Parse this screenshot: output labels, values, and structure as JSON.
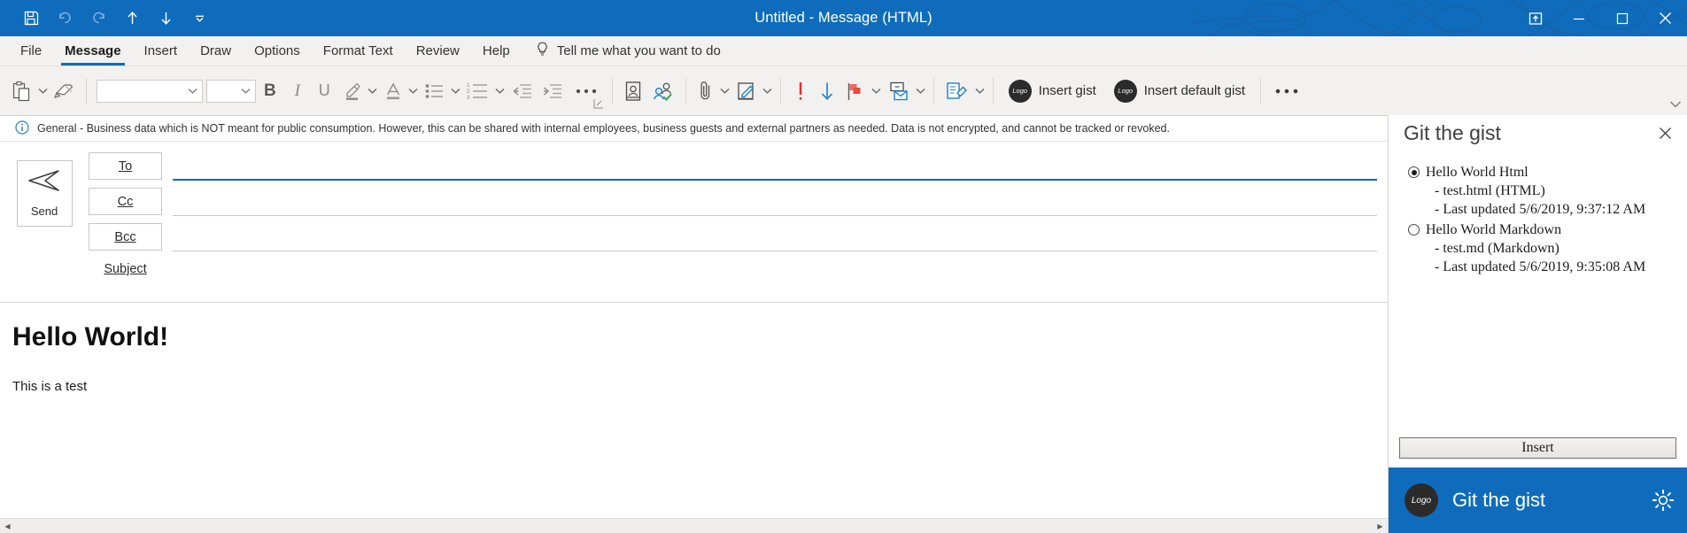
{
  "window": {
    "title": "Untitled  -  Message (HTML)",
    "quick_access": [
      {
        "name": "save-button",
        "label": "Save",
        "disabled": false
      },
      {
        "name": "undo-button",
        "label": "Undo",
        "disabled": true
      },
      {
        "name": "redo-button",
        "label": "Redo",
        "disabled": true
      },
      {
        "name": "previous-item-button",
        "label": "Previous Item",
        "disabled": false
      },
      {
        "name": "next-item-button",
        "label": "Next Item",
        "disabled": false
      },
      {
        "name": "customize-quick-access-toolbar-button",
        "label": "Customize Quick Access Toolbar",
        "disabled": false
      }
    ],
    "controls": [
      {
        "name": "ribbon-display-options-button",
        "label": "Ribbon Display Options"
      },
      {
        "name": "minimize-button",
        "label": "Minimize"
      },
      {
        "name": "maximize-button",
        "label": "Maximize"
      },
      {
        "name": "close-button",
        "label": "Close"
      }
    ],
    "accent_color": "#0f6cbd"
  },
  "ribbon": {
    "tabs": [
      {
        "label": "File",
        "active": false
      },
      {
        "label": "Message",
        "active": true
      },
      {
        "label": "Insert",
        "active": false
      },
      {
        "label": "Draw",
        "active": false
      },
      {
        "label": "Options",
        "active": false
      },
      {
        "label": "Format Text",
        "active": false
      },
      {
        "label": "Review",
        "active": false
      },
      {
        "label": "Help",
        "active": false
      }
    ],
    "tell_me": {
      "icon": "lightbulb-icon",
      "placeholder": "Tell me what you want to do"
    },
    "clipboard": {
      "paste_label": "Paste",
      "format_painter_label": "Format Painter"
    },
    "font": {
      "name_value": "",
      "name_placeholder": "",
      "size_value": "",
      "size_placeholder": "",
      "bold_label": "B",
      "italic_label": "I",
      "underline_label": "U",
      "highlight_label": "Text Highlight Color",
      "font_color_label": "Font Color"
    },
    "paragraph": {
      "bullets_label": "Bullets",
      "numbering_label": "Numbering",
      "decrease_indent_label": "Decrease Indent",
      "increase_indent_label": "Increase Indent",
      "more_label": "More Commands"
    },
    "names": {
      "address_book_label": "Address Book",
      "check_names_label": "Check Names"
    },
    "include": {
      "attach_file_label": "Attach File",
      "signature_label": "Signature"
    },
    "tags": {
      "high_importance_label": "High Importance",
      "low_importance_label": "Low Importance",
      "follow_up_label": "Follow Up"
    },
    "more_groups": {
      "immersive_label": "Immersive Reader",
      "view_templates_label": "View Templates"
    },
    "addins": [
      {
        "name": "insert-gist-button",
        "label": "Insert gist",
        "icon_text": "Logo"
      },
      {
        "name": "insert-default-gist-button",
        "label": "Insert default gist",
        "icon_text": "Logo"
      }
    ],
    "overflow_label": "• • •",
    "collapse_label": "Collapse the Ribbon"
  },
  "sensitivity_banner": {
    "icon": "info-icon",
    "text": "General - Business data which is NOT meant for public consumption. However, this can be shared with internal employees, business guests and external partners as needed. Data is not encrypted, and cannot be tracked or revoked."
  },
  "compose": {
    "send_button": {
      "label": "Send",
      "icon": "send-arrow-icon"
    },
    "fields": [
      {
        "name": "to-field",
        "button_label": "To",
        "accesskey": "T",
        "value": "",
        "focused": true
      },
      {
        "name": "cc-field",
        "button_label": "Cc",
        "accesskey": "C",
        "value": "",
        "focused": false
      },
      {
        "name": "bcc-field",
        "button_label": "Bcc",
        "accesskey": "B",
        "value": "",
        "focused": false
      }
    ],
    "subject": {
      "label": "Subject",
      "accesskey": "S",
      "value": ""
    },
    "body": {
      "heading": "Hello World!",
      "paragraph": "This is a test"
    },
    "scrollbar": {
      "left_arrow": "◀",
      "right_arrow": "▶"
    }
  },
  "taskpane": {
    "title": "Git the gist",
    "close_label": "Close",
    "gists": [
      {
        "selected": true,
        "name": "Hello World Html",
        "file_line": "- test.html (HTML)",
        "updated_line": "- Last updated 5/6/2019, 9:37:12 AM"
      },
      {
        "selected": false,
        "name": "Hello World Markdown",
        "file_line": "- test.md (Markdown)",
        "updated_line": "- Last updated 5/6/2019, 9:35:08 AM"
      }
    ],
    "insert_button_label": "Insert",
    "footer": {
      "logo_text": "Logo",
      "title": "Git the gist",
      "settings_label": "Settings"
    }
  }
}
